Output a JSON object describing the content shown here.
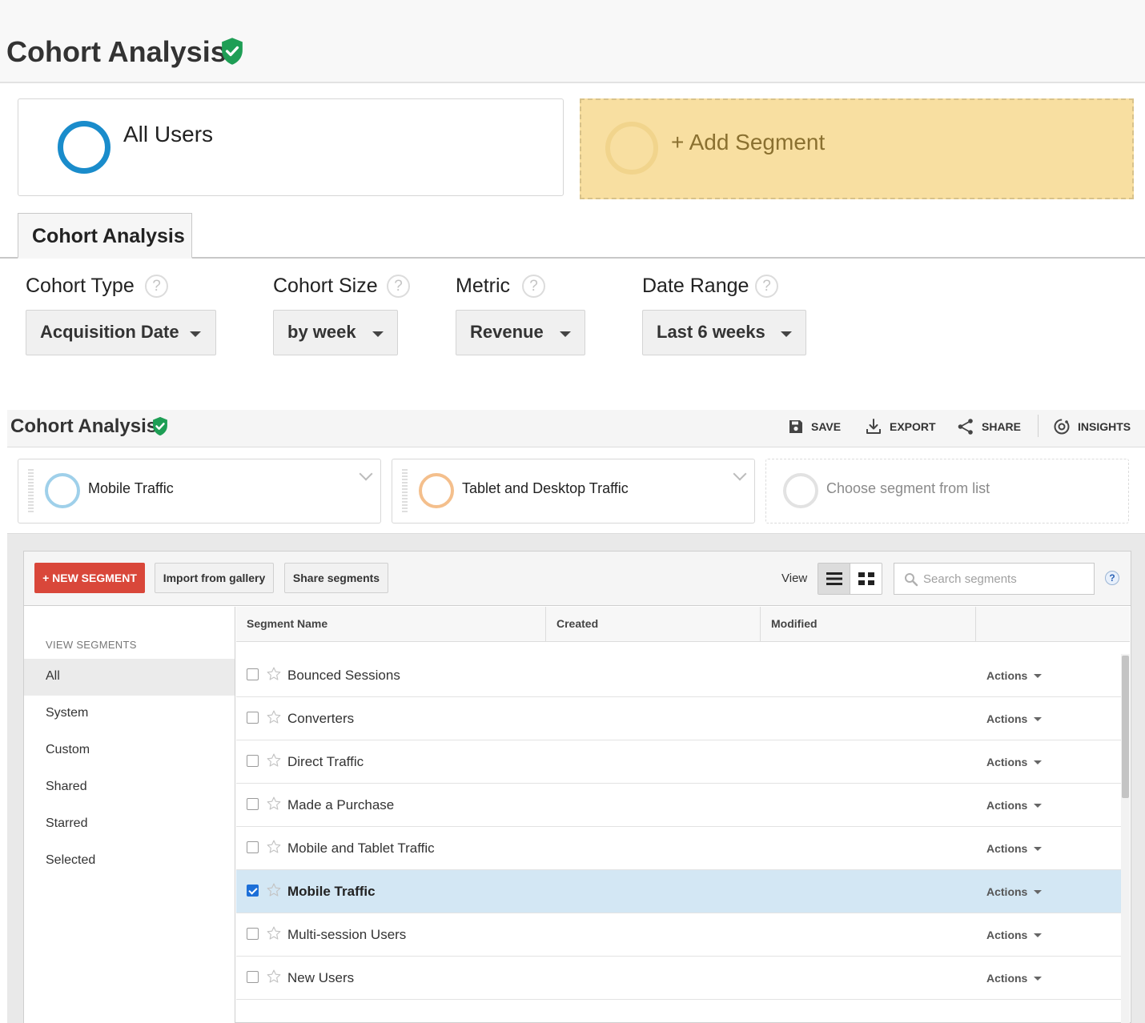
{
  "top_panel": {
    "title": "Cohort Analysis",
    "segment": {
      "label": "All Users",
      "color": "#1a8ccb"
    },
    "add_segment": {
      "label": "+ Add Segment"
    },
    "tab": "Cohort Analysis",
    "controls": [
      {
        "label": "Cohort Type",
        "value": "Acquisition Date"
      },
      {
        "label": "Cohort Size",
        "value": "by week"
      },
      {
        "label": "Metric",
        "value": "Revenue"
      },
      {
        "label": "Date Range",
        "value": "Last 6 weeks"
      }
    ],
    "help_glyph": "?"
  },
  "report_header": {
    "title": "Cohort Analysis",
    "actions": {
      "save": "SAVE",
      "export": "EXPORT",
      "share": "SHARE",
      "insights": "INSIGHTS"
    }
  },
  "segment_strip": {
    "segments": [
      {
        "name": "Mobile Traffic",
        "color": "#9fd0ea"
      },
      {
        "name": "Tablet and Desktop Traffic",
        "color": "#f4bf8c"
      }
    ],
    "placeholder": "Choose segment from list"
  },
  "segment_picker": {
    "new_segment": "+ NEW SEGMENT",
    "import": "Import from gallery",
    "share": "Share segments",
    "view_label": "View",
    "search_placeholder": "Search segments",
    "help": "?",
    "sidebar": {
      "title": "VIEW SEGMENTS",
      "items": [
        "All",
        "System",
        "Custom",
        "Shared",
        "Starred",
        "Selected"
      ],
      "active": "All"
    },
    "columns": [
      "Segment Name",
      "Created",
      "Modified"
    ],
    "action_label": "Actions",
    "rows": [
      {
        "name": "Bounced Sessions",
        "checked": false
      },
      {
        "name": "Converters",
        "checked": false
      },
      {
        "name": "Direct Traffic",
        "checked": false
      },
      {
        "name": "Made a Purchase",
        "checked": false
      },
      {
        "name": "Mobile and Tablet Traffic",
        "checked": false
      },
      {
        "name": "Mobile Traffic",
        "checked": true
      },
      {
        "name": "Multi-session Users",
        "checked": false
      },
      {
        "name": "New Users",
        "checked": false
      }
    ]
  }
}
